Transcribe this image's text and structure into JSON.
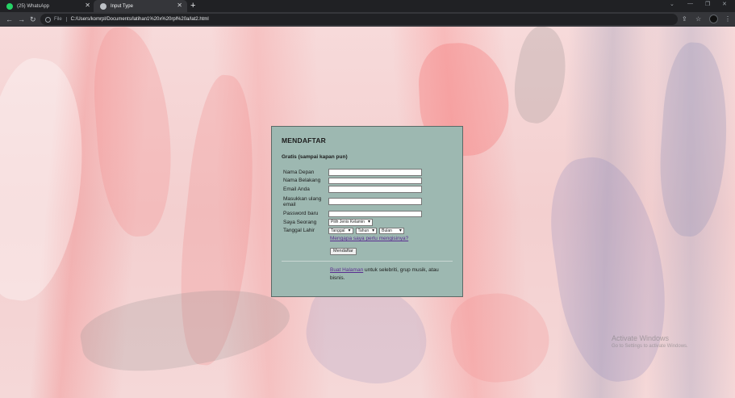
{
  "tabs": [
    {
      "label": "(25) WhatsApp",
      "icon": "whatsapp-icon"
    },
    {
      "label": "Input Type",
      "icon": "globe-icon"
    }
  ],
  "address": {
    "scheme_label": "File",
    "url": "C:/Users/komrpl/Documents/latihan1%20x%20rpl%20a/lat2.html"
  },
  "form": {
    "title": "MENDAFTAR",
    "subtitle": "Gratis (sampai kapan pun)",
    "fields": {
      "first_name": "Nama Depan",
      "last_name": "Nama Belakang",
      "email": "Email Anda",
      "email_repeat": "Masukkan ulang email",
      "password": "Password baru",
      "gender": "Saya Seorang",
      "birthdate": "Tanggal Lahir"
    },
    "gender_select": "Pilih Jenis Kelamin",
    "date_selects": {
      "day": "Tanggal",
      "year": "Tahun",
      "month": "Bulan"
    },
    "why_link": "Mengapa saya perlu mengisinya?",
    "submit": "Mendaftar",
    "footer_link": "Buat Halaman",
    "footer_text": "untuk selebriti, grup musik, atau bisnis."
  },
  "watermark": {
    "line1": "Activate Windows",
    "line2": "Go to Settings to activate Windows."
  }
}
